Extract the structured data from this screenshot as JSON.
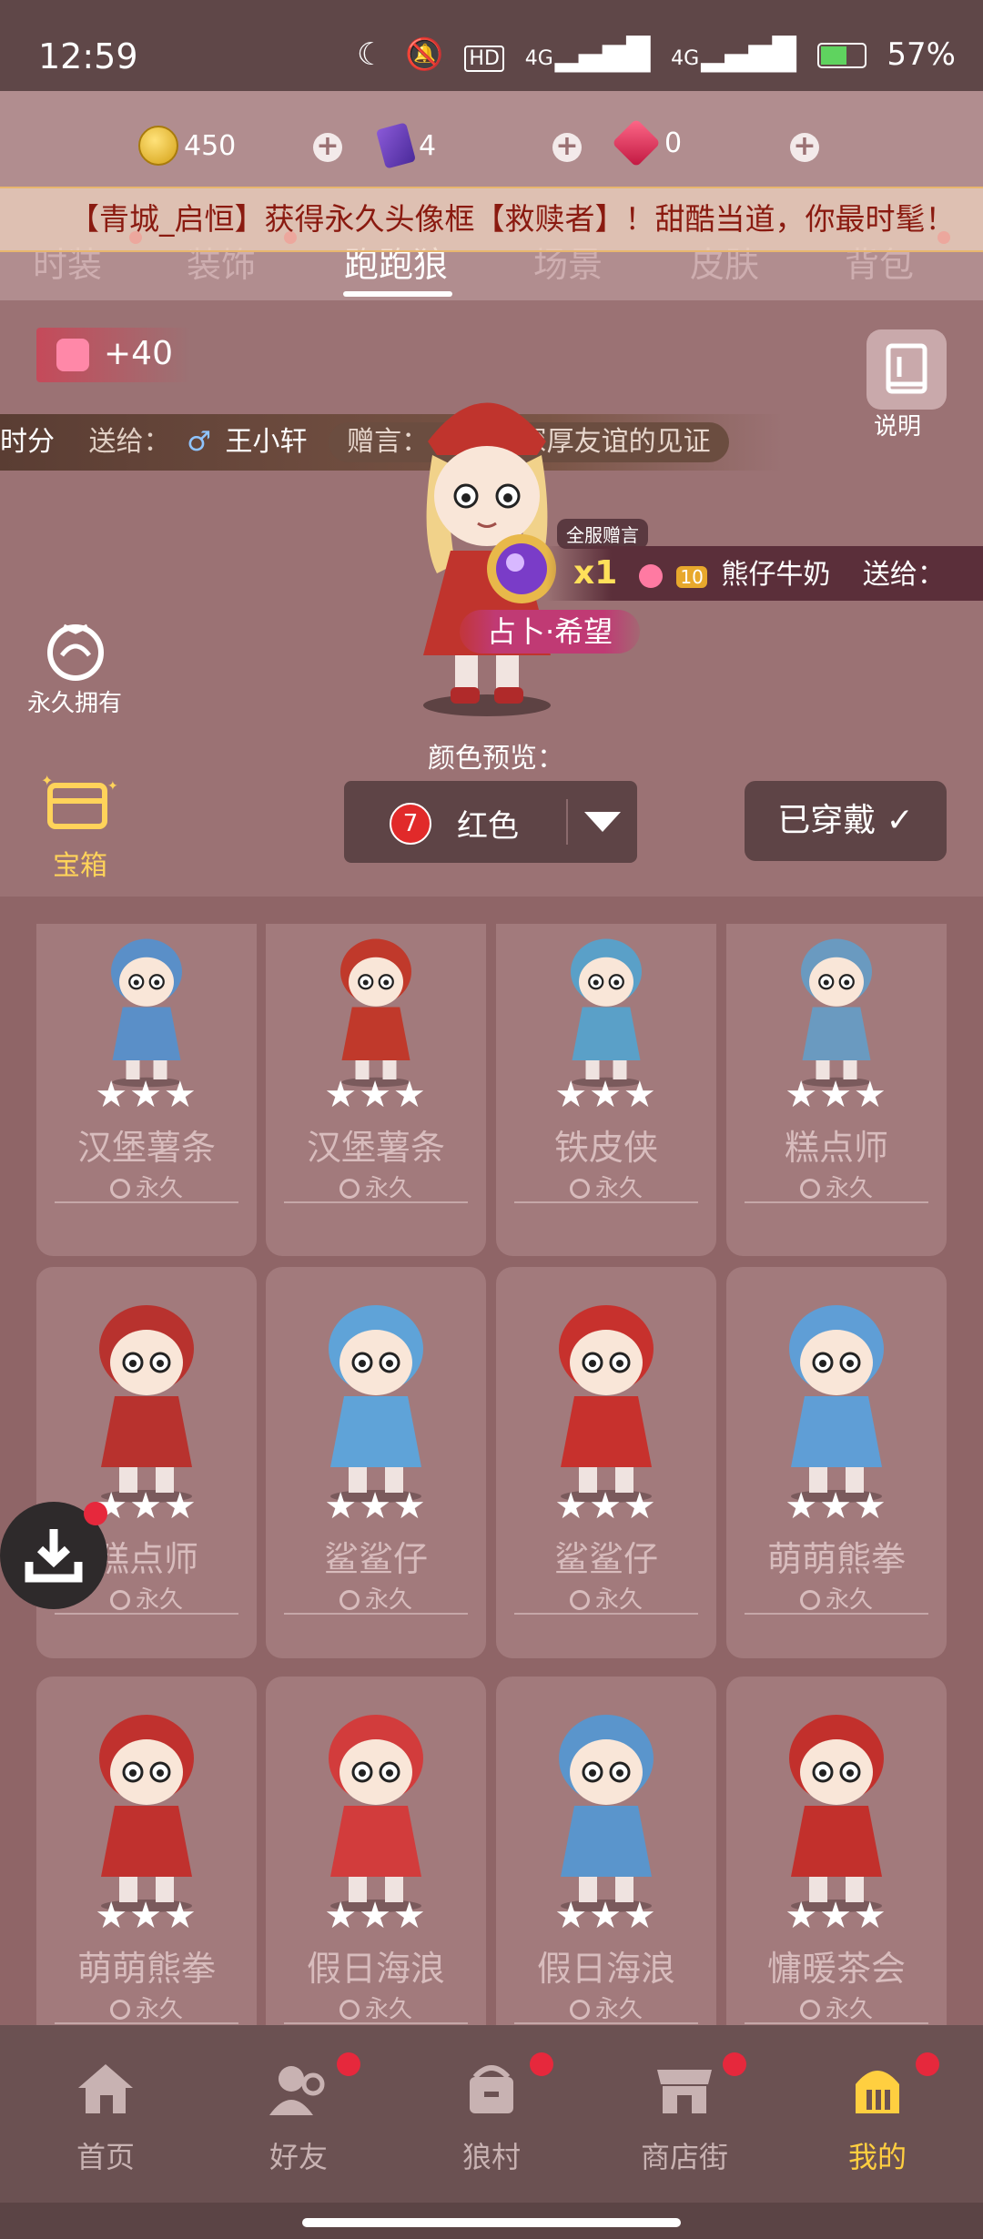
{
  "status_bar": {
    "time": "12:59",
    "moon": "☾",
    "mute": "🔕",
    "hd": "HD",
    "net1": "4G",
    "net2": "4G",
    "battery": "57%"
  },
  "currency": {
    "coins": "450",
    "cards": "4",
    "gems": "0"
  },
  "tabs": [
    "时装",
    "装饰",
    "跑跑狼",
    "场景",
    "皮肤",
    "背包"
  ],
  "broadcast": "【青城_启恒】获得永久头像框【救赎者】！甜酷当道，你最时髦！",
  "score_chip": "+40",
  "gift_message_1": {
    "prefix": "时分",
    "send_label": "送给：",
    "gender": "♂",
    "recipient": "王小轩",
    "message": "赠言：  礼物是深厚友谊的见证"
  },
  "gift_message_2": {
    "badge": "全服赠言",
    "multiplier": "x1",
    "level": "10",
    "sender": "熊仔牛奶",
    "send_label": "送给："
  },
  "hero": {
    "name": "占卜·希望"
  },
  "help_label": "说明",
  "permanent_label": "永久拥有",
  "chest_label": "宝箱",
  "color_preview": {
    "label": "颜色预览：",
    "number": "7",
    "name": "红色"
  },
  "worn_button": "已穿戴 ✓",
  "items": [
    {
      "name": "汉堡薯条",
      "stars": "★★★",
      "duration": "永久",
      "color": "#5a8fc8"
    },
    {
      "name": "汉堡薯条",
      "stars": "★★★",
      "duration": "永久",
      "color": "#c0392b"
    },
    {
      "name": "铁皮侠",
      "stars": "★★★",
      "duration": "永久",
      "color": "#5aa0c8"
    },
    {
      "name": "糕点师",
      "stars": "★★★",
      "duration": "永久",
      "color": "#6a9ac0"
    },
    {
      "name": "糕点师",
      "stars": "★★★",
      "duration": "永久",
      "color": "#b8322e"
    },
    {
      "name": "鲨鲨仔",
      "stars": "★★★",
      "duration": "永久",
      "color": "#5fa3d8"
    },
    {
      "name": "鲨鲨仔",
      "stars": "★★★",
      "duration": "永久",
      "color": "#c7312d"
    },
    {
      "name": "萌萌熊拳",
      "stars": "★★★",
      "duration": "永久",
      "color": "#5f9ed6"
    },
    {
      "name": "萌萌熊拳",
      "stars": "★★★",
      "duration": "永久",
      "color": "#c0312e"
    },
    {
      "name": "假日海浪",
      "stars": "★★★",
      "duration": "永久",
      "color": "#d23c3c"
    },
    {
      "name": "假日海浪",
      "stars": "★★★",
      "duration": "永久",
      "color": "#5a95cc"
    },
    {
      "name": "慵暖茶会",
      "stars": "★★★",
      "duration": "永久",
      "color": "#c2302c"
    }
  ],
  "bottom_nav": [
    "首页",
    "好友",
    "狼村",
    "商店街",
    "我的"
  ]
}
